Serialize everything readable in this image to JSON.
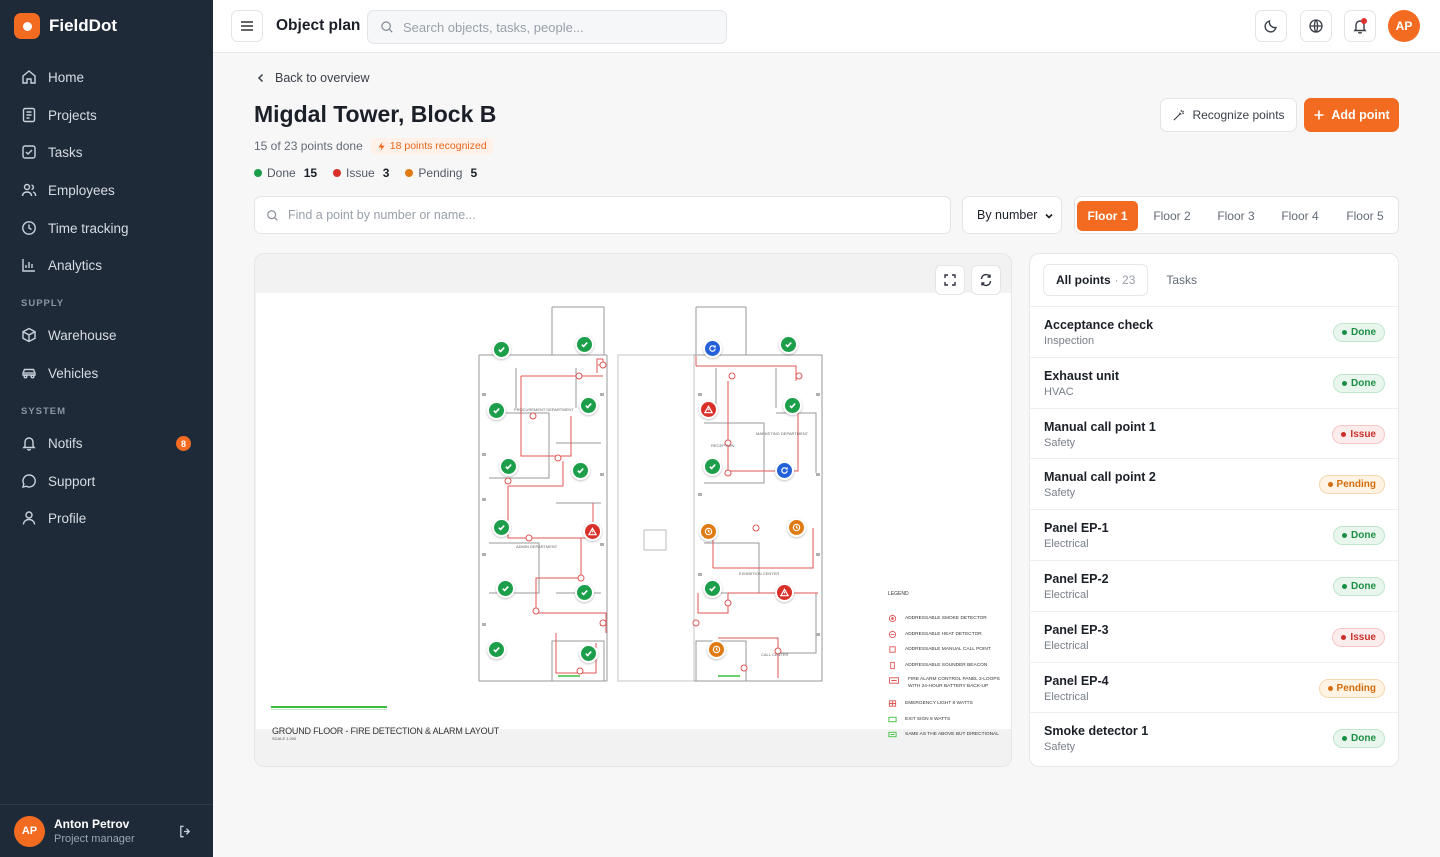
{
  "app": {
    "name": "FieldDot"
  },
  "sidebar": {
    "items": [
      {
        "label": "Home",
        "icon": "home-icon"
      },
      {
        "label": "Projects",
        "icon": "projects-icon"
      },
      {
        "label": "Tasks",
        "icon": "tasks-icon"
      },
      {
        "label": "Employees",
        "icon": "employees-icon"
      },
      {
        "label": "Time tracking",
        "icon": "clock-icon"
      },
      {
        "label": "Analytics",
        "icon": "analytics-icon"
      }
    ],
    "supply_label": "SUPPLY",
    "supply_items": [
      {
        "label": "Warehouse",
        "icon": "box-icon"
      },
      {
        "label": "Vehicles",
        "icon": "car-icon"
      }
    ],
    "system_label": "SYSTEM",
    "system_items": [
      {
        "label": "Notifs",
        "icon": "bell-icon",
        "badge": "8"
      },
      {
        "label": "Support",
        "icon": "chat-icon"
      },
      {
        "label": "Profile",
        "icon": "user-icon"
      }
    ],
    "user": {
      "initials": "AP",
      "name": "Anton Petrov",
      "role": "Project manager"
    }
  },
  "topbar": {
    "title": "Object plan",
    "search_placeholder": "Search objects, tasks, people...",
    "avatar_initials": "AP"
  },
  "page": {
    "back_label": "Back to overview",
    "title": "Migdal Tower, Block B",
    "progress_text": "15 of 23 points done",
    "recognized_badge": "18 points recognized",
    "stats": [
      {
        "label": "Done",
        "count": "15",
        "color": "#1c9e4a"
      },
      {
        "label": "Issue",
        "count": "3",
        "color": "#d9302a"
      },
      {
        "label": "Pending",
        "count": "5",
        "color": "#e07a12"
      }
    ],
    "recognize_button": "Recognize points",
    "add_button": "Add point",
    "find_placeholder": "Find a point by number or name...",
    "sort_value": "By number",
    "floors": [
      "Floor 1",
      "Floor 2",
      "Floor 3",
      "Floor 4",
      "Floor 5"
    ],
    "active_floor": "Floor 1"
  },
  "plan": {
    "caption": "GROUND FLOOR - FIRE DETECTION & ALARM LAYOUT",
    "scale": "SCALE 1:200",
    "room_labels": [
      "PROCUREMENT DEPARTMENT",
      "MARKETING DEPARTMENT",
      "RECEPTION",
      "ADMIN DEPARTMENT",
      "EXHIBITION CENTER",
      "CALL CENTER"
    ],
    "legend_title": "LEGEND",
    "legend": [
      "ADDRESSABLE SMOKE DETECTOR",
      "ADDRESSABLE HEAT DETECTOR",
      "ADDRESSABLE MANUAL CALL POINT",
      "ADDRESSABLE SOUNDER BEACON",
      "FIRE ALARM CONTROL PANEL 2-LOOPS WITH 24-HOUR BATTERY BACK-UP",
      "EMERGENCY LIGHT 8 WATTS",
      "EXIT SIGN 8 WATTS",
      "SAME AS THE ABOVE BUT DIRECTIONAL"
    ]
  },
  "panel": {
    "tabs": [
      {
        "label": "All points",
        "count": "23"
      },
      {
        "label": "Tasks"
      }
    ],
    "points": [
      {
        "name": "Acceptance check",
        "category": "Inspection",
        "status": "Done"
      },
      {
        "name": "Exhaust unit",
        "category": "HVAC",
        "status": "Done"
      },
      {
        "name": "Manual call point 1",
        "category": "Safety",
        "status": "Issue"
      },
      {
        "name": "Manual call point 2",
        "category": "Safety",
        "status": "Pending"
      },
      {
        "name": "Panel EP-1",
        "category": "Electrical",
        "status": "Done"
      },
      {
        "name": "Panel EP-2",
        "category": "Electrical",
        "status": "Done"
      },
      {
        "name": "Panel EP-3",
        "category": "Electrical",
        "status": "Issue"
      },
      {
        "name": "Panel EP-4",
        "category": "Electrical",
        "status": "Pending"
      },
      {
        "name": "Smoke detector 1",
        "category": "Safety",
        "status": "Done"
      }
    ]
  },
  "colors": {
    "accent": "#f36b21",
    "sidebar": "#1f2a38",
    "done": "#1c9e4a",
    "issue": "#d9302a",
    "pending": "#e07a12",
    "active": "#2460d8"
  }
}
